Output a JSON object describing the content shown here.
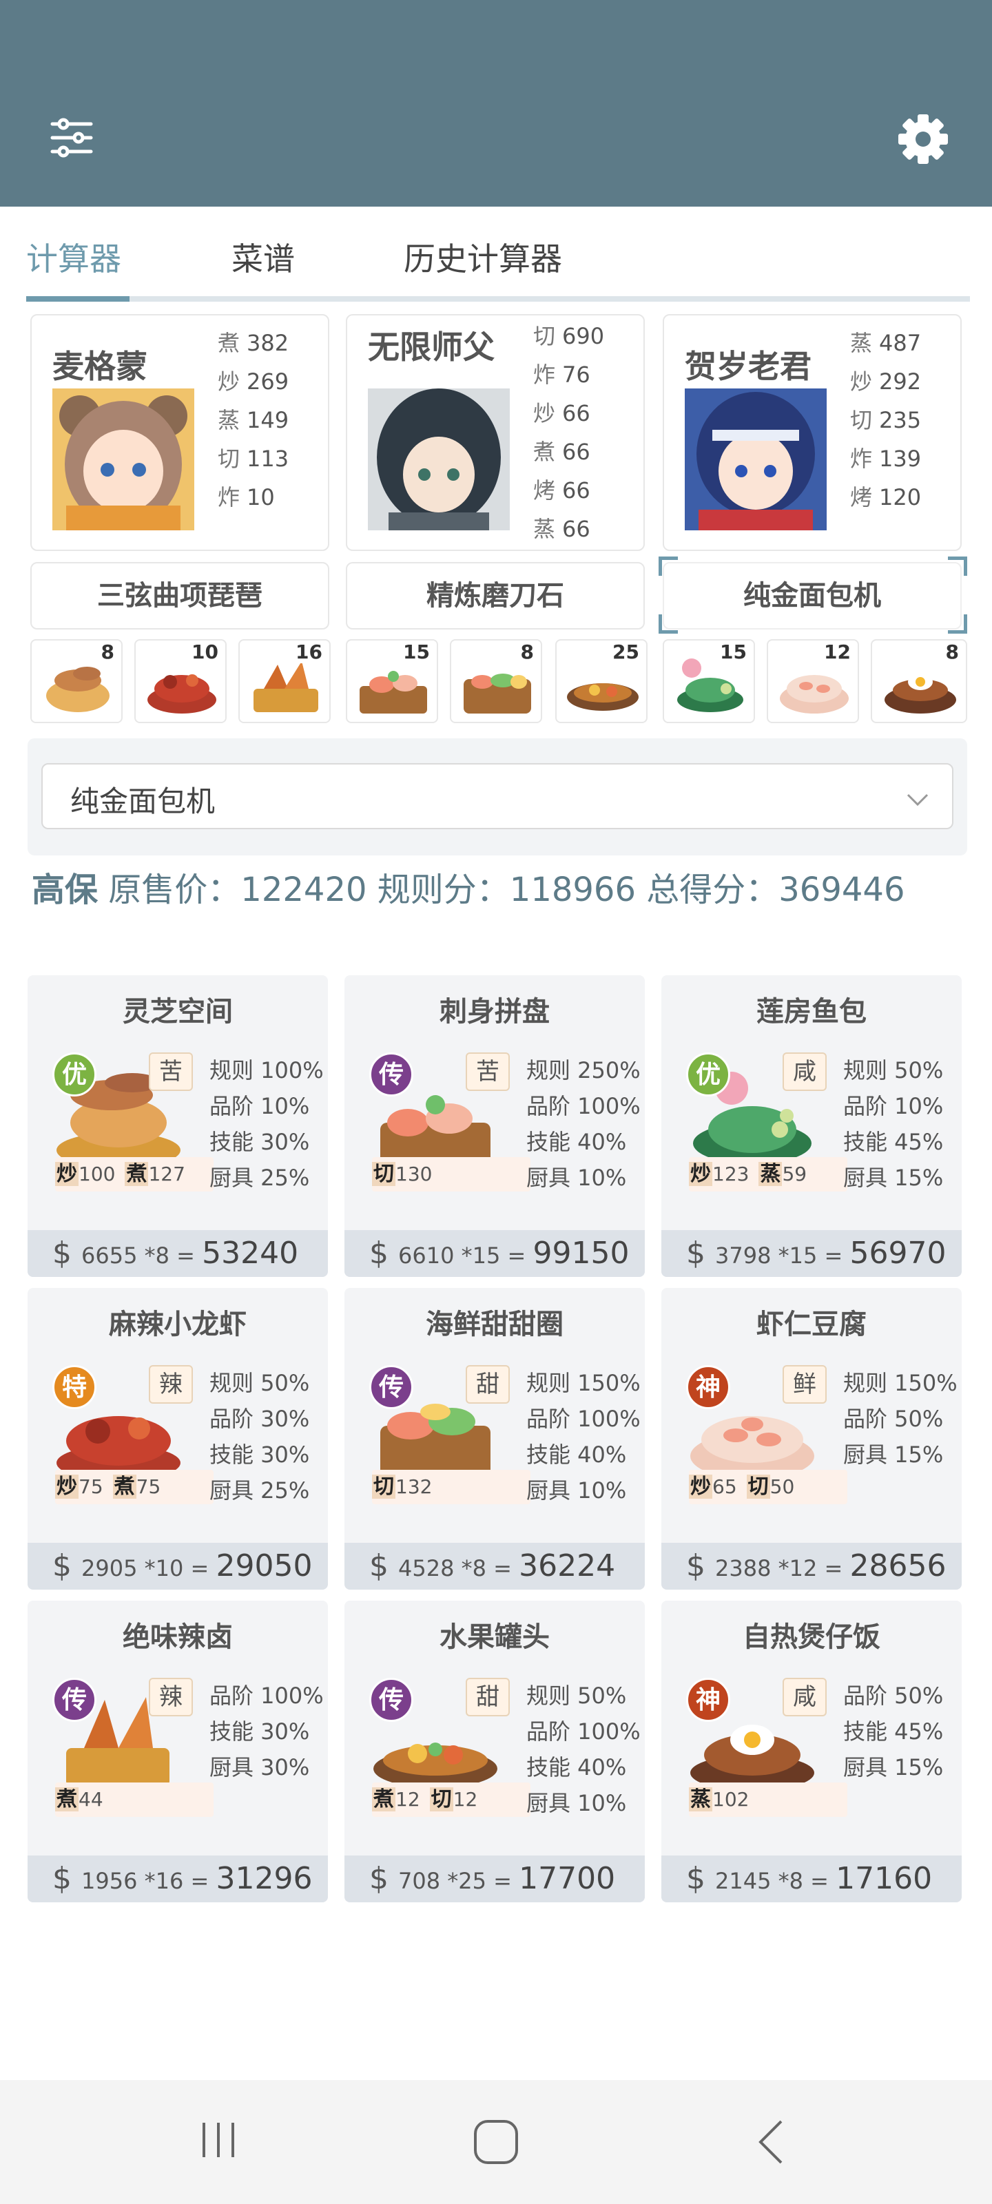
{
  "tabs": [
    "计算器",
    "菜谱",
    "历史计算器"
  ],
  "chefs": [
    {
      "name": "麦格蒙",
      "stats": [
        [
          "煮",
          "382"
        ],
        [
          "炒",
          "269"
        ],
        [
          "蒸",
          "149"
        ],
        [
          "切",
          "113"
        ],
        [
          "炸",
          "10"
        ]
      ]
    },
    {
      "name": "无限师父",
      "stats": [
        [
          "切",
          "690"
        ],
        [
          "炸",
          "76"
        ],
        [
          "炒",
          "66"
        ],
        [
          "煮",
          "66"
        ],
        [
          "烤",
          "66"
        ],
        [
          "蒸",
          "66"
        ]
      ]
    },
    {
      "name": "贺岁老君",
      "stats": [
        [
          "蒸",
          "487"
        ],
        [
          "炒",
          "292"
        ],
        [
          "切",
          "235"
        ],
        [
          "炸",
          "139"
        ],
        [
          "烤",
          "120"
        ]
      ]
    }
  ],
  "equipment": [
    "三弦曲项琵琶",
    "精炼磨刀石",
    "纯金面包机"
  ],
  "dish_counts": [
    "8",
    "10",
    "16",
    "15",
    "8",
    "25",
    "15",
    "12",
    "8"
  ],
  "select_value": "纯金面包机",
  "summary": {
    "tag": "高保",
    "text": "原售价：122420 规则分：118966 总得分：369446"
  },
  "recipes": [
    {
      "name": "灵芝空间",
      "rarity": "优",
      "flavor": "苦",
      "skills": [
        [
          "炒",
          "100"
        ],
        [
          "煮",
          "127"
        ]
      ],
      "stats": [
        "规则 100%",
        "品阶 10%",
        "技能 30%",
        "厨具 25%"
      ],
      "price_unit": "6655",
      "qty": "*8",
      "total": "53240"
    },
    {
      "name": "刺身拼盘",
      "rarity": "传",
      "flavor": "苦",
      "skills": [
        [
          "切",
          "130"
        ]
      ],
      "stats": [
        "规则 250%",
        "品阶 100%",
        "技能 40%",
        "厨具 10%"
      ],
      "price_unit": "6610",
      "qty": "*15",
      "total": "99150"
    },
    {
      "name": "莲房鱼包",
      "rarity": "优",
      "flavor": "咸",
      "skills": [
        [
          "炒",
          "123"
        ],
        [
          "蒸",
          "59"
        ]
      ],
      "stats": [
        "规则 50%",
        "品阶 10%",
        "技能 45%",
        "厨具 15%"
      ],
      "price_unit": "3798",
      "qty": "*15",
      "total": "56970"
    },
    {
      "name": "麻辣小龙虾",
      "rarity": "特",
      "flavor": "辣",
      "skills": [
        [
          "炒",
          "75"
        ],
        [
          "煮",
          "75"
        ]
      ],
      "stats": [
        "规则 50%",
        "品阶 30%",
        "技能 30%",
        "厨具 25%"
      ],
      "price_unit": "2905",
      "qty": "*10",
      "total": "29050"
    },
    {
      "name": "海鲜甜甜圈",
      "rarity": "传",
      "flavor": "甜",
      "skills": [
        [
          "切",
          "132"
        ]
      ],
      "stats": [
        "规则 150%",
        "品阶 100%",
        "技能 40%",
        "厨具 10%"
      ],
      "price_unit": "4528",
      "qty": "*8",
      "total": "36224"
    },
    {
      "name": "虾仁豆腐",
      "rarity": "神",
      "flavor": "鲜",
      "skills": [
        [
          "炒",
          "65"
        ],
        [
          "切",
          "50"
        ]
      ],
      "stats": [
        "规则 150%",
        "品阶 50%",
        "厨具 15%"
      ],
      "price_unit": "2388",
      "qty": "*12",
      "total": "28656"
    },
    {
      "name": "绝味辣卤",
      "rarity": "传",
      "flavor": "辣",
      "skills": [
        [
          "煮",
          "44"
        ]
      ],
      "stats": [
        "品阶 100%",
        "技能 30%",
        "厨具 30%"
      ],
      "price_unit": "1956",
      "qty": "*16",
      "total": "31296"
    },
    {
      "name": "水果罐头",
      "rarity": "传",
      "flavor": "甜",
      "skills": [
        [
          "煮",
          "12"
        ],
        [
          "切",
          "12"
        ]
      ],
      "stats": [
        "规则 50%",
        "品阶 100%",
        "技能 40%",
        "厨具 10%"
      ],
      "price_unit": "708",
      "qty": "*25",
      "total": "17700"
    },
    {
      "name": "自热煲仔饭",
      "rarity": "神",
      "flavor": "咸",
      "skills": [
        [
          "蒸",
          "102"
        ]
      ],
      "stats": [
        "品阶 50%",
        "技能 45%",
        "厨具 15%"
      ],
      "price_unit": "2145",
      "qty": "*8",
      "total": "17160"
    }
  ],
  "currency_symbol": "$",
  "equals": "=",
  "icons": {
    "menu": "sliders-icon",
    "settings": "gear-icon",
    "dropdown": "chevron-down-icon",
    "nav": [
      "recent-apps-icon",
      "home-icon",
      "back-icon"
    ]
  },
  "colors": {
    "appbar": "#5d7b88",
    "accent": "#6e9aac",
    "rarity_you": "#7cb342",
    "rarity_chuan": "#7b3f8c",
    "rarity_te": "#e58a1f",
    "rarity_shen": "#c0441e"
  }
}
